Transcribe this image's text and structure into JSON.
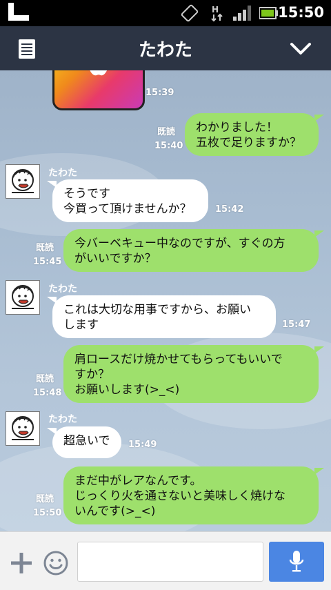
{
  "status": {
    "time": "15:50"
  },
  "header": {
    "title": "たわた"
  },
  "chat": {
    "first_time": "15:39",
    "messages": [
      {
        "id": "m1",
        "read": "既読",
        "time": "15:40",
        "lines": [
          "わかりました！",
          "五枚で足りますか？"
        ]
      },
      {
        "id": "m2",
        "sender": "たわた",
        "time": "15:42",
        "lines": [
          "そうです",
          "今買って頂けませんか？"
        ]
      },
      {
        "id": "m3",
        "read": "既読",
        "time": "15:45",
        "lines": [
          "今バーベキュー中なのですが、すぐの方",
          "がいいですか？"
        ]
      },
      {
        "id": "m4",
        "sender": "たわた",
        "time": "15:47",
        "lines": [
          "これは大切な用事ですから、お願い",
          "します"
        ]
      },
      {
        "id": "m5",
        "read": "既読",
        "time": "15:48",
        "lines": [
          "肩ロースだけ焼かせてもらってもいいで",
          "すか？",
          "お願いします(>_<)"
        ]
      },
      {
        "id": "m6",
        "sender": "たわた",
        "time": "15:49",
        "lines": [
          "超急いで"
        ]
      },
      {
        "id": "m7",
        "read": "既読",
        "time": "15:50",
        "lines": [
          "まだ中がレアなんです。",
          "じっくり火を通さないと美味しく焼けな",
          "いんです(>_<)"
        ]
      }
    ]
  },
  "input": {
    "value": ""
  },
  "icons": {
    "menu": "menu-icon",
    "chevron": "chevron-down-icon",
    "plus": "plus-icon",
    "emoji": "smiley-icon",
    "mic": "microphone-icon"
  },
  "colors": {
    "header": "#2c3444",
    "my_bubble": "#9ee06c",
    "their_bubble": "#ffffff",
    "send": "#4b86e3"
  }
}
